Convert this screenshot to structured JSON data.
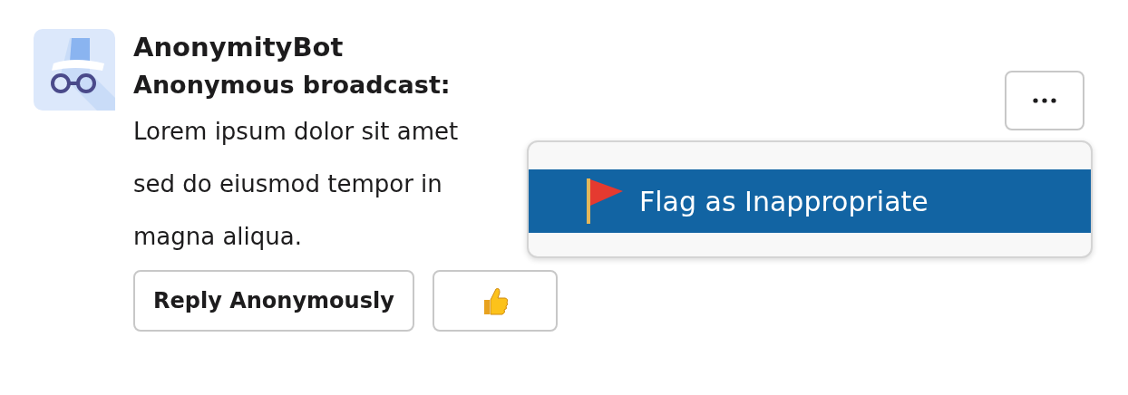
{
  "message": {
    "sender": "AnonymityBot",
    "heading": "Anonymous broadcast:",
    "lines": [
      "Lorem ipsum dolor sit amet",
      "sed do eiusmod tempor in",
      "magna aliqua."
    ]
  },
  "actions": [
    {
      "kind": "text",
      "label": "Reply Anonymously"
    },
    {
      "kind": "thumbs-up"
    }
  ],
  "more_menu": {
    "items": [
      {
        "label": "Flag as Inappropriate",
        "selected": true
      }
    ]
  }
}
